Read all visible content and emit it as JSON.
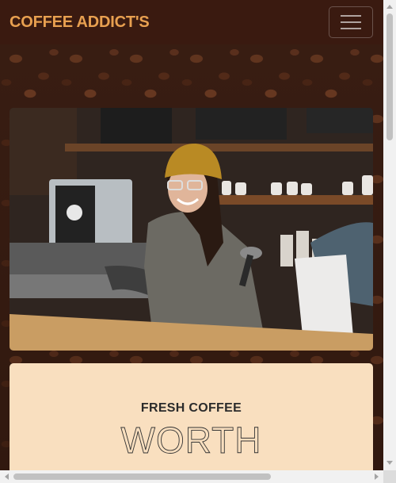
{
  "navbar": {
    "brand": "COFFEE ADDICT'S",
    "toggler_icon": "hamburger-menu-icon"
  },
  "hero": {
    "image_subject": "barista smiling at espresso machine"
  },
  "card": {
    "subheading": "FRESH COFFEE",
    "heading": "WORTH"
  },
  "colors": {
    "brand": "#e8a050",
    "navbar_bg": "#3a1a10",
    "card_bg": "#f9dfbf"
  }
}
